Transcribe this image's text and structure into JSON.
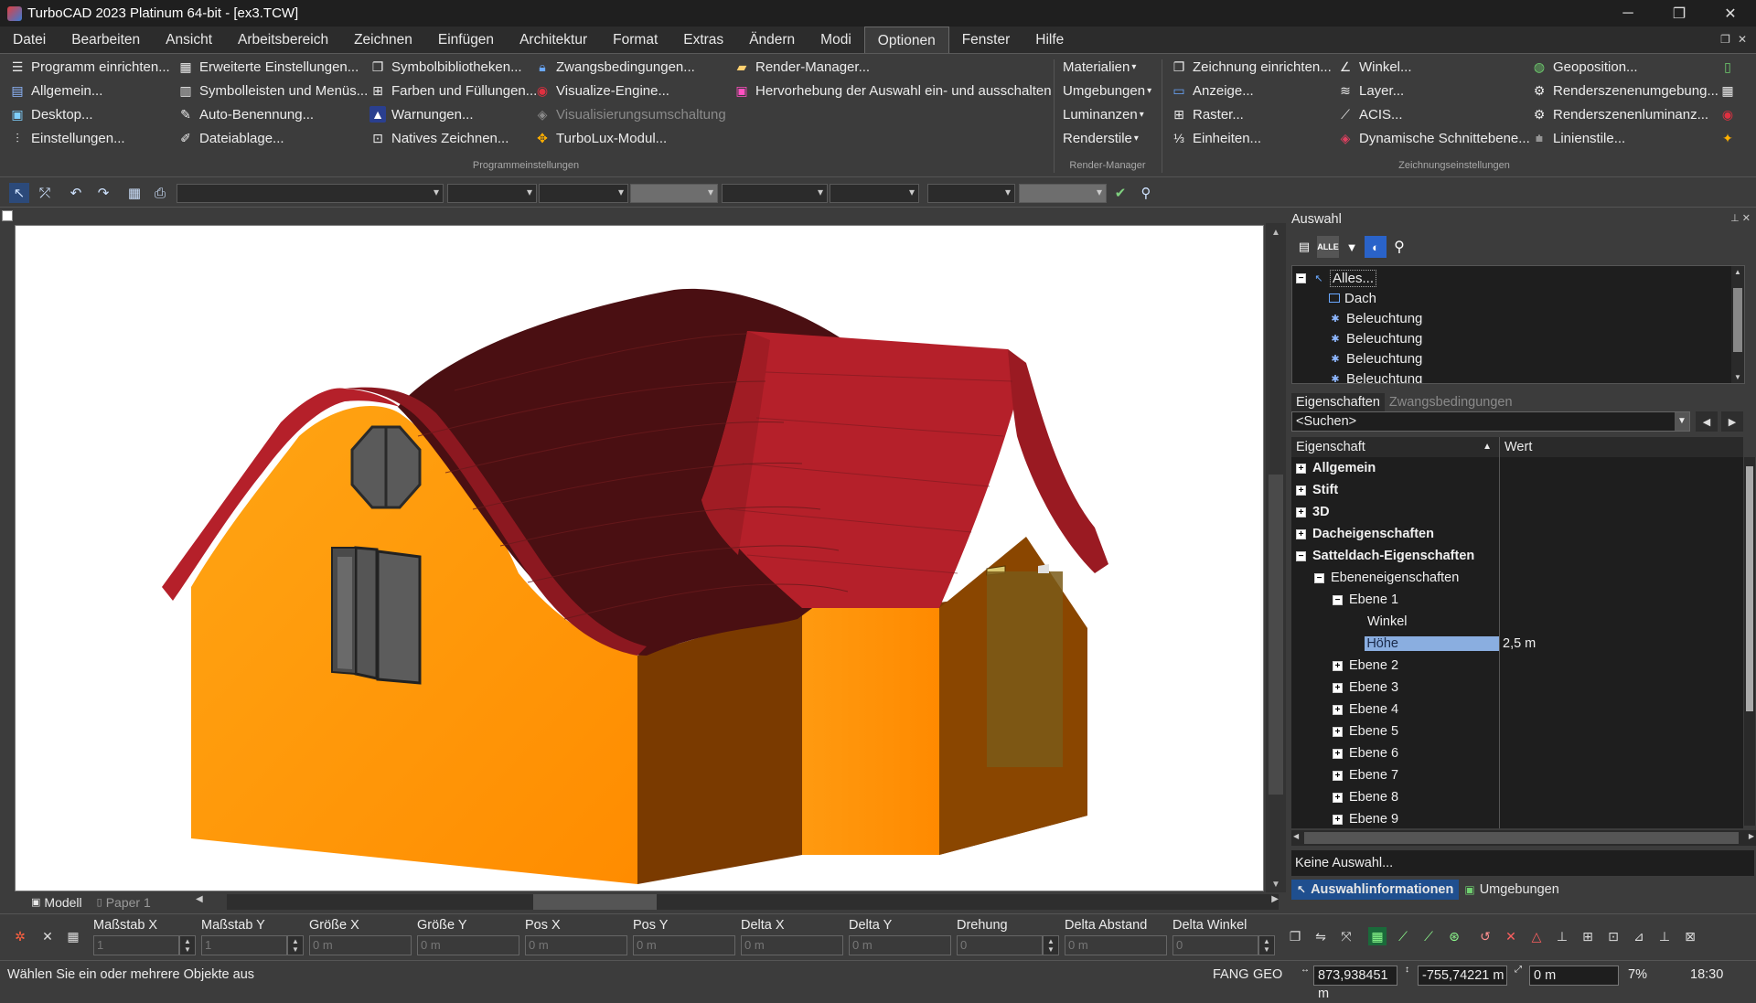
{
  "window": {
    "title": "TurboCAD 2023 Platinum 64-bit - [ex3.TCW]",
    "minimize": "─",
    "maximize": "❐",
    "close": "✕"
  },
  "menu": {
    "items": [
      "Datei",
      "Bearbeiten",
      "Ansicht",
      "Arbeitsbereich",
      "Zeichnen",
      "Einfügen",
      "Architektur",
      "Format",
      "Extras",
      "Ändern",
      "Modi",
      "Optionen",
      "Fenster",
      "Hilfe"
    ],
    "active": "Optionen",
    "mdi_controls": [
      "❐",
      "✕"
    ]
  },
  "ribbon": {
    "programm": {
      "group_label": "Programmeinstellungen",
      "col1": [
        "Programm einrichten...",
        "Allgemein...",
        "Desktop...",
        "Einstellungen..."
      ],
      "col2": [
        "Erweiterte Einstellungen...",
        "Symbolleisten und Menüs...",
        "Auto-Benennung...",
        "Dateiablage..."
      ],
      "col3": [
        "Symbolbibliotheken...",
        "Farben und Füllungen...",
        "Warnungen...",
        "Natives Zeichnen..."
      ],
      "col4": [
        "Zwangsbedingungen...",
        "Visualize-Engine...",
        "Visualisierungsumschaltung",
        "TurboLux-Modul..."
      ],
      "col5": [
        "Render-Manager...",
        "Hervorhebung der Auswahl ein- und ausschalten"
      ]
    },
    "render": {
      "group_label": "Render-Manager",
      "items": [
        "Materialien",
        "Umgebungen",
        "Luminanzen",
        "Renderstile"
      ]
    },
    "zeichnung": {
      "group_label": "Zeichnungseinstellungen",
      "col1": [
        "Zeichnung einrichten...",
        "Anzeige...",
        "Raster...",
        "Einheiten..."
      ],
      "col2": [
        "Winkel...",
        "Layer...",
        "ACIS...",
        "Dynamische Schnittebene..."
      ],
      "col3": [
        "Geoposition...",
        "Renderszenenumgebung...",
        "Renderszenenluminanz...",
        "Linienstile..."
      ]
    }
  },
  "viewport": {
    "sheet_tabs": [
      "Modell",
      "Paper 1"
    ],
    "active_sheet": "Modell"
  },
  "panel": {
    "title": "Auswahl",
    "pin": "⊥ ✕",
    "tree": [
      {
        "label": "Alles...",
        "level": 0,
        "icon": "cursor-icon"
      },
      {
        "label": "Dach",
        "level": 1,
        "icon": "roof-object-icon"
      },
      {
        "label": "Beleuchtung",
        "level": 1,
        "icon": "light-icon"
      },
      {
        "label": "Beleuchtung",
        "level": 1,
        "icon": "light-icon"
      },
      {
        "label": "Beleuchtung",
        "level": 1,
        "icon": "light-icon"
      },
      {
        "label": "Beleuchtung",
        "level": 1,
        "icon": "light-icon"
      }
    ],
    "tabs": [
      "Eigenschaften",
      "Zwangsbedingungen"
    ],
    "active_tab": "Eigenschaften",
    "search_value": "<Suchen>",
    "grid_headers": [
      "Eigenschaft",
      "Wert"
    ],
    "rows": [
      {
        "label": "Allgemein",
        "indent": 0,
        "bold": true,
        "expander": "+",
        "value": ""
      },
      {
        "label": "Stift",
        "indent": 0,
        "bold": true,
        "expander": "+",
        "value": ""
      },
      {
        "label": "3D",
        "indent": 0,
        "bold": true,
        "expander": "+",
        "value": ""
      },
      {
        "label": "Dacheigenschaften",
        "indent": 0,
        "bold": true,
        "expander": "+",
        "value": ""
      },
      {
        "label": "Satteldach-Eigenschaften",
        "indent": 0,
        "bold": true,
        "expander": "−",
        "value": ""
      },
      {
        "label": "Ebeneneigenschaften",
        "indent": 1,
        "bold": false,
        "expander": "−",
        "value": ""
      },
      {
        "label": "Ebene 1",
        "indent": 2,
        "bold": false,
        "expander": "−",
        "value": ""
      },
      {
        "label": "Winkel",
        "indent": 3,
        "bold": false,
        "expander": "",
        "value": ""
      },
      {
        "label": "Höhe",
        "indent": 3,
        "bold": false,
        "expander": "",
        "value": "2,5 m",
        "selected": true
      },
      {
        "label": "Ebene 2",
        "indent": 2,
        "bold": false,
        "expander": "+",
        "value": ""
      },
      {
        "label": "Ebene 3",
        "indent": 2,
        "bold": false,
        "expander": "+",
        "value": ""
      },
      {
        "label": "Ebene 4",
        "indent": 2,
        "bold": false,
        "expander": "+",
        "value": ""
      },
      {
        "label": "Ebene 5",
        "indent": 2,
        "bold": false,
        "expander": "+",
        "value": ""
      },
      {
        "label": "Ebene 6",
        "indent": 2,
        "bold": false,
        "expander": "+",
        "value": ""
      },
      {
        "label": "Ebene 7",
        "indent": 2,
        "bold": false,
        "expander": "+",
        "value": ""
      },
      {
        "label": "Ebene 8",
        "indent": 2,
        "bold": false,
        "expander": "+",
        "value": ""
      },
      {
        "label": "Ebene 9",
        "indent": 2,
        "bold": false,
        "expander": "+",
        "value": ""
      }
    ],
    "selection_info": "Keine Auswahl...",
    "bottom_tabs": [
      "Auswahlinformationen",
      "Umgebungen"
    ]
  },
  "inspector": {
    "labels": [
      "Maßstab X",
      "Maßstab Y",
      "Größe X",
      "Größe Y",
      "Pos X",
      "Pos Y",
      "Delta X",
      "Delta Y",
      "Drehung",
      "Delta Abstand",
      "Delta Winkel"
    ],
    "values": [
      "1",
      "1",
      "0 m",
      "0 m",
      "0 m",
      "0 m",
      "0 m",
      "0 m",
      "0",
      "0 m",
      "0"
    ]
  },
  "status": {
    "prompt": "Wählen Sie ein oder mehrere Objekte aus",
    "fang": "FANG",
    "geo": "GEO",
    "coord_x": "873,938451 m",
    "coord_y": "-755,74221 m",
    "coord_z": "0 m",
    "zoom": "7%",
    "time": "18:30"
  },
  "colors": {
    "accent": "#1f4f8f",
    "wall_light": "#ff9a10",
    "wall_dark": "#7a3d00",
    "roof_dark": "#4a0f12",
    "roof_red": "#b5202a"
  }
}
